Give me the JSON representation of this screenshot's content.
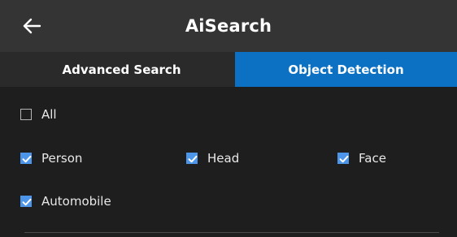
{
  "app": {
    "title": "AiSearch",
    "back_icon": "arrow-left-icon"
  },
  "tabs": [
    {
      "label": "Advanced Search",
      "active": false
    },
    {
      "label": "Object Detection",
      "active": true
    }
  ],
  "options": [
    {
      "label": "All",
      "checked": false
    },
    {
      "label": "Person",
      "checked": true
    },
    {
      "label": "Head",
      "checked": true
    },
    {
      "label": "Face",
      "checked": true
    },
    {
      "label": "Automobile",
      "checked": true
    }
  ],
  "colors": {
    "accent": "#0c71c3",
    "checkbox": "#4c95e8",
    "titlebar": "#343434",
    "background": "#1e1e1e"
  }
}
